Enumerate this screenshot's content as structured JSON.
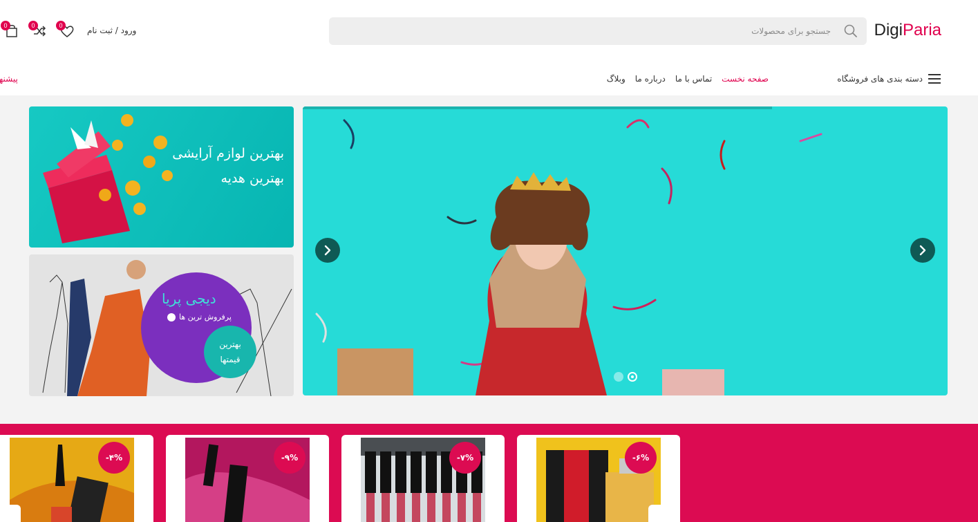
{
  "header": {
    "logo_part1": "Digi",
    "logo_part2": "Paria",
    "search_placeholder": "جستجو برای محصولات",
    "login_label": "ورود / ثبت نام",
    "wishlist_count": "0",
    "compare_count": "0",
    "cart_count": "0"
  },
  "nav": {
    "categories_label": "دسته بندی های فروشگاه",
    "links": [
      "صفحه نخست",
      "تماس با ما",
      "درباره ما",
      "وبلاگ"
    ],
    "offer_label": "پیشنهاد"
  },
  "banners": {
    "banner1_line1": "بهترین لوازم آرایشی",
    "banner1_line2": "بهترین هدیه",
    "banner2_title": "دیجی پریا",
    "banner2_sub": "پرفروش ترین ها",
    "banner2_badge_line1": "بهترین",
    "banner2_badge_line2": "قیمتها"
  },
  "slider": {
    "active_slide": 2,
    "slide_count": 2
  },
  "deals": {
    "cards": [
      {
        "discount": "-۶%"
      },
      {
        "discount": "-۷%"
      },
      {
        "discount": "-۹%"
      },
      {
        "discount": "-۴%"
      }
    ]
  },
  "colors": {
    "brand": "#e0004d",
    "deal_band": "#dc0b52",
    "slider_bg": "#26dbd7",
    "banner2_purple": "#7b2fbe"
  }
}
